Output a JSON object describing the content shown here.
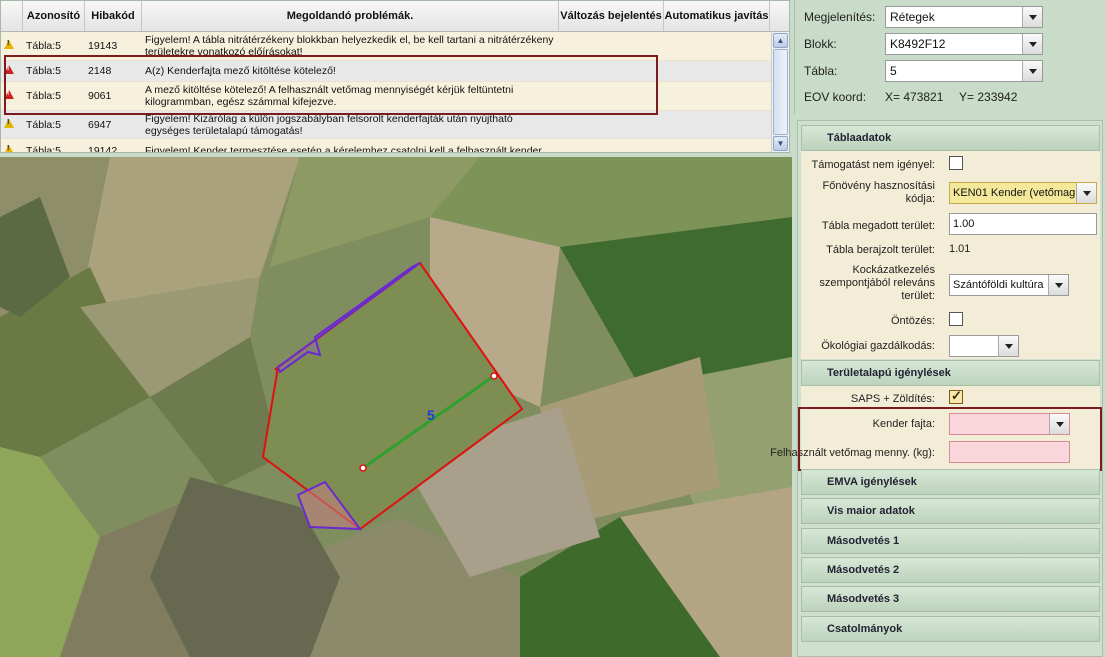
{
  "errors": {
    "columns": [
      "",
      "Azonosító",
      "Hibakód",
      "Megoldandó problémák.",
      "Változás bejelentés",
      "Automatikus javítás"
    ],
    "rows": [
      {
        "level": "warning",
        "id": "Tábla:5",
        "code": "19143",
        "msg": "Figyelem! A tábla nitrátérzékeny blokkban helyezkedik el, be kell tartani a nitrátérzékeny területekre vonatkozó előírásokat!"
      },
      {
        "level": "error",
        "id": "Tábla:5",
        "code": "2148",
        "msg": "A(z) Kenderfajta mező kitöltése kötelező!"
      },
      {
        "level": "error",
        "id": "Tábla:5",
        "code": "9061",
        "msg": "A mező kitöltése kötelező! A felhasznált vetőmag mennyiségét kérjük feltüntetni kilogrammban, egész számmal kifejezve."
      },
      {
        "level": "warning",
        "id": "Tábla:5",
        "code": "6947",
        "msg": "Figyelem! Kizárólag a külön jogszabályban felsorolt kenderfajták után nyújtható egységes területalapú támogatás!"
      },
      {
        "level": "warning",
        "id": "Tábla:5",
        "code": "19142",
        "msg": "Figyelem! Kender termesztése esetén a kérelemhez csatolni kell a felhasznált kender"
      }
    ]
  },
  "topform": {
    "display_label": "Megjelenítés:",
    "display_value": "Rétegek",
    "block_label": "Blokk:",
    "block_value": "K8492F12",
    "table_label": "Tábla:",
    "table_value": "5",
    "eov_label": "EOV koord:",
    "eov_x": "X= 473821",
    "eov_y": "Y= 233942"
  },
  "map": {
    "parcel_label": "5"
  },
  "panel": {
    "tabla_header": "Táblaadatok",
    "no_support_label": "Támogatást nem igényel:",
    "main_crop_label": "Főnövény hasznosítási kódja:",
    "main_crop_value": "KEN01 Kender (vetőmag",
    "declared_area_label": "Tábla megadott terület:",
    "declared_area_value": "1.00",
    "drawn_area_label": "Tábla berajzolt terület:",
    "drawn_area_value": "1.01",
    "risk_label": "Kockázatkezelés szempontjából releváns terület:",
    "risk_value": "Szántóföldi kultúra",
    "irrigation_label": "Öntözés:",
    "eco_label": "Ökológiai gazdálkodás:",
    "eco_value": "",
    "area_header": "Területalapú igénylések",
    "saps_label": "SAPS + Zöldítés:",
    "hemp_label": "Kender fajta:",
    "hemp_value": "",
    "seed_label": "Felhasznált vetőmag menny. (kg):",
    "seed_value": "",
    "sections": [
      "EMVA igénylések",
      "Vis maior adatok",
      "Másodvetés 1",
      "Másodvetés 2",
      "Másodvetés 3",
      "Csatolmányok"
    ]
  }
}
